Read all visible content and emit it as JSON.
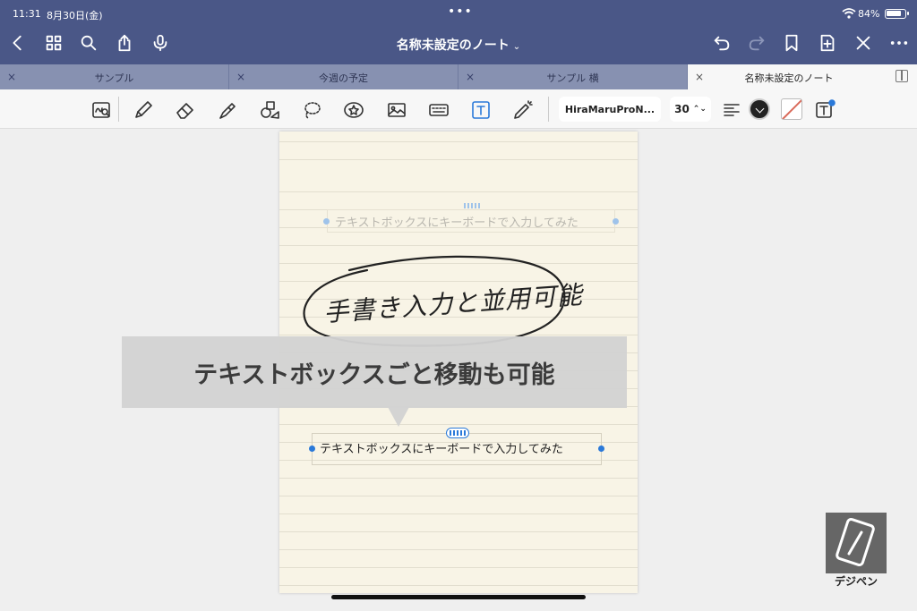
{
  "status_bar": {
    "time": "11:31",
    "date": "8月30日(金)",
    "battery": "84%"
  },
  "header": {
    "title": "名称未設定のノート"
  },
  "tabs": [
    {
      "label": "サンプル",
      "active": false
    },
    {
      "label": "今週の予定",
      "active": false
    },
    {
      "label": "サンプル 横",
      "active": false
    },
    {
      "label": "名称未設定のノート",
      "active": true
    }
  ],
  "toolbar": {
    "font_name": "HiraMaruProN...",
    "font_size": "30",
    "text_color": "#222222"
  },
  "page": {
    "textbox_ghost": "テキストボックスにキーボードで入力してみた",
    "textbox_active": "テキストボックスにキーボードで入力してみた",
    "handwriting": "手書き入力と並用可能"
  },
  "caption": {
    "text": "テキストボックスごと移動も可能"
  },
  "logo": {
    "text": "デジペン"
  },
  "colors": {
    "header_bg": "#4a5787",
    "tab_bar_bg": "#8791b1",
    "selection_blue": "#2a79d9",
    "paper": "#f8f4e6"
  }
}
